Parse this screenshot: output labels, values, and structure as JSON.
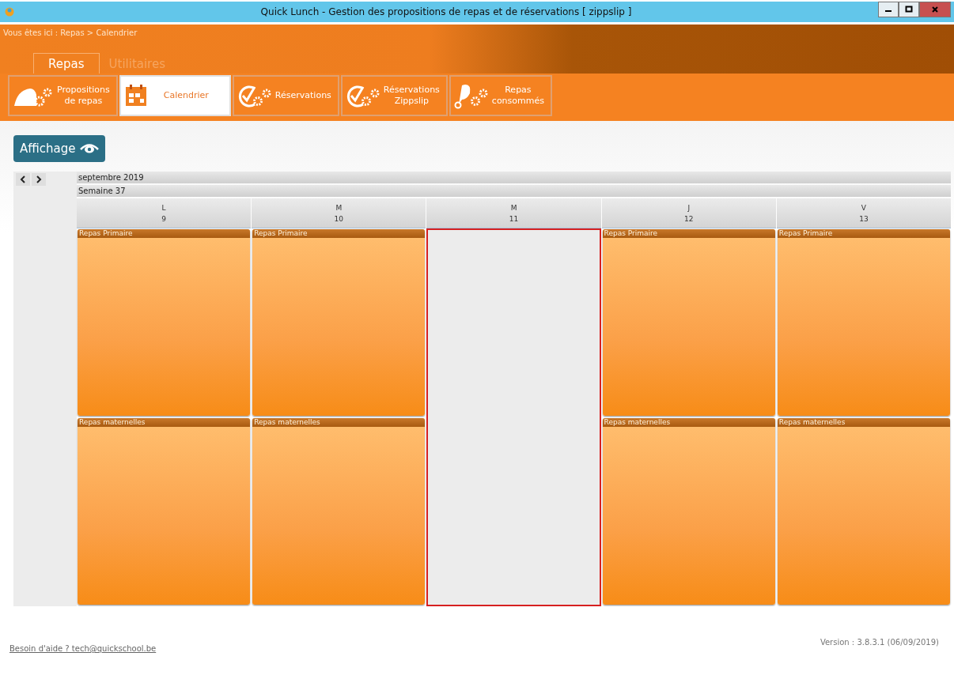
{
  "window": {
    "title": "Quick Lunch - Gestion des propositions de repas et de réservations [ zippslip ]"
  },
  "breadcrumb": "Vous êtes ici :  Repas > Calendrier",
  "tabs": [
    {
      "label": "Repas",
      "selected": true
    },
    {
      "label": "Utilitaires",
      "selected": false
    }
  ],
  "toolbar": [
    {
      "kind": "cloche",
      "label": "Propositions\nde repas",
      "selected": false
    },
    {
      "kind": "calendar",
      "label": "Calendrier",
      "selected": true
    },
    {
      "kind": "check",
      "label": "Réservations",
      "selected": false
    },
    {
      "kind": "check",
      "label": "Réservations\nZippslip",
      "selected": false
    },
    {
      "kind": "drumstick",
      "label": "Repas\nconsommés",
      "selected": false
    }
  ],
  "view_button": {
    "label": "Affichage"
  },
  "calendar": {
    "month": "septembre 2019",
    "week": "Semaine 37",
    "days": [
      {
        "letter": "L",
        "number": "9",
        "selected": false,
        "meals": [
          "Repas Primaire",
          "Repas maternelles"
        ]
      },
      {
        "letter": "M",
        "number": "10",
        "selected": false,
        "meals": [
          "Repas Primaire",
          "Repas maternelles"
        ]
      },
      {
        "letter": "M",
        "number": "11",
        "selected": true
      },
      {
        "letter": "J",
        "number": "12",
        "selected": false,
        "meals": [
          "Repas Primaire",
          "Repas maternelles"
        ]
      },
      {
        "letter": "V",
        "number": "13",
        "selected": false,
        "meals": [
          "Repas Primaire",
          "Repas maternelles"
        ]
      }
    ]
  },
  "footer": {
    "help": "Besoin d'aide ? tech@quickschool.be",
    "version": "Version : 3.8.3.1 (06/09/2019)"
  }
}
